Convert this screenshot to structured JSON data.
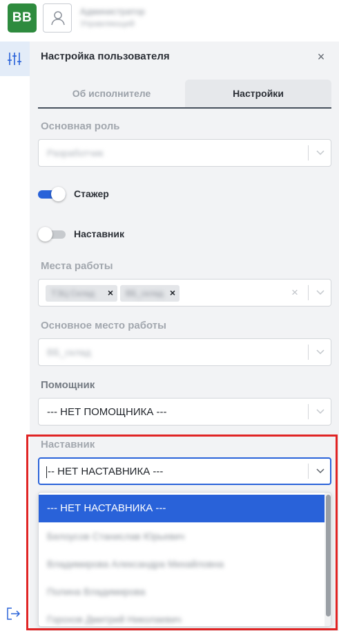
{
  "header": {
    "logo_text": "BB",
    "user_name": "Администратор",
    "user_role": "Управляющий"
  },
  "panel": {
    "title": "Настройка пользователя",
    "close_glyph": "×",
    "tabs": [
      {
        "label": "Об исполнителе",
        "active": false
      },
      {
        "label": "Настройки",
        "active": true
      }
    ]
  },
  "fields": {
    "main_role": {
      "label": "Основная роль",
      "value": "Разработчик"
    },
    "trainee": {
      "label": "Стажер",
      "checked": true
    },
    "mentor_toggle": {
      "label": "Наставник",
      "checked": false
    },
    "workplaces": {
      "label": "Места работы",
      "chips": [
        "ТЭЦ Склад",
        "ВБ_склад"
      ]
    },
    "main_workplace": {
      "label": "Основное место работы",
      "value": "ВБ_склад"
    },
    "assistant": {
      "label": "Помощник",
      "value": "--- НЕТ ПОМОЩНИКА ---"
    },
    "mentor": {
      "label": "Наставник",
      "value": "-- НЕТ НАСТАВНИКА ---"
    }
  },
  "mentor_menu": {
    "options": [
      {
        "label": "--- НЕТ НАСТАВНИКА ---",
        "selected": true
      },
      {
        "label": "Белоусов Станислав Юрьевич",
        "selected": false
      },
      {
        "label": "Владимирова Александра Михайловна",
        "selected": false
      },
      {
        "label": "Полина Владимирова",
        "selected": false
      },
      {
        "label": "Горохов Дмитрий Николаевич",
        "selected": false
      }
    ]
  },
  "colors": {
    "accent": "#2962d9",
    "logo_bg": "#2e8b3e",
    "highlight": "#e02424"
  },
  "icons": {
    "settings": "sliders-icon",
    "user": "user-icon",
    "logout": "logout-icon",
    "chevron": "chevron-down-icon"
  }
}
